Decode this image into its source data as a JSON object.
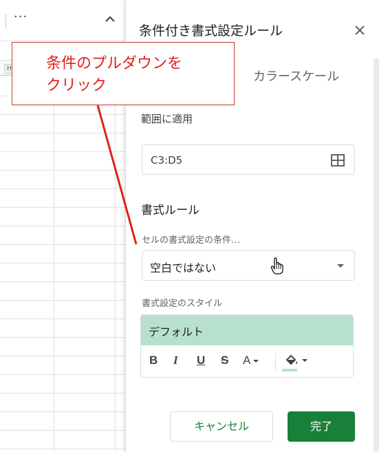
{
  "sheet": {
    "more_label": "···",
    "column_header": "H"
  },
  "panel": {
    "title": "条件付き書式設定ルール",
    "tab_color_scale": "カラースケール",
    "range_label": "範囲に適用",
    "range_value": "C3:D5",
    "rules_label": "書式ルール",
    "condition_label": "セルの書式設定の条件…",
    "condition_value": "空白ではない",
    "style_label": "書式設定のスタイル",
    "style_preview": "デフォルト",
    "format_buttons": {
      "bold": "B",
      "italic": "I",
      "underline": "U",
      "strikethrough": "S",
      "text_color": "A"
    },
    "cancel_label": "キャンセル",
    "done_label": "完了"
  },
  "callout": {
    "line1": "条件のプルダウンを",
    "line2": "クリック"
  },
  "colors": {
    "accent_green": "#188038",
    "style_preview_bg": "#b7e1cd",
    "callout_red": "#e0201b"
  },
  "icons": {
    "close": "close-icon",
    "range_grid": "grid-select-icon",
    "dropdown": "chevron-down-icon",
    "fill": "fill-color-icon",
    "cursor": "hand-cursor-icon",
    "collapse": "chevron-up-icon"
  }
}
